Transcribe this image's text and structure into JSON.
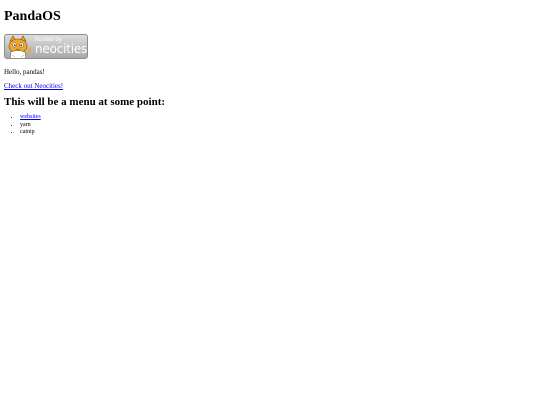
{
  "title": "PandaOS",
  "badge": {
    "line1": "hosted by",
    "line2": "neocities"
  },
  "greeting": "Hello, pandas!",
  "neocities_link": "Check out Neocities!",
  "menu": {
    "heading": "This will be a menu at some point:",
    "items": [
      {
        "label": "websites",
        "is_link": true
      },
      {
        "label": "yarn",
        "is_link": false
      },
      {
        "label": "catnip",
        "is_link": false
      }
    ]
  },
  "colors": {
    "link": "#0000ee",
    "text": "#000000",
    "background": "#ffffff"
  }
}
